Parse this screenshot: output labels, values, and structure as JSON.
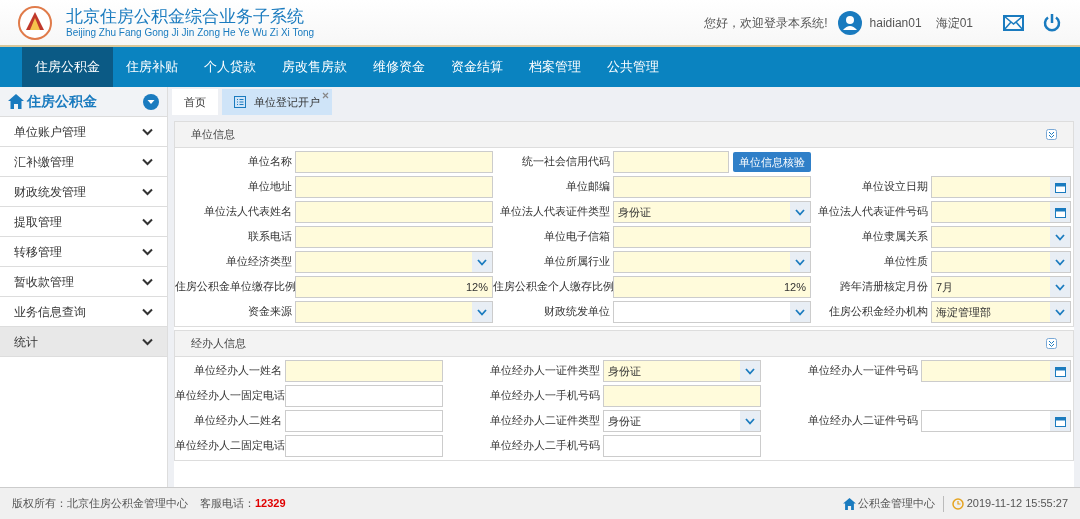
{
  "header": {
    "title": "北京住房公积金综合业务子系统",
    "subtitle": "Beijing Zhu Fang Gong Ji Jin Zong He Ye Wu Zi Xi Tong",
    "greeting": "您好，欢迎登录本系统!",
    "username": "haidian01",
    "org": "海淀01"
  },
  "nav": [
    {
      "label": "住房公积金",
      "selected": true
    },
    {
      "label": "住房补贴",
      "selected": false
    },
    {
      "label": "个人贷款",
      "selected": false
    },
    {
      "label": "房改售房款",
      "selected": false
    },
    {
      "label": "维修资金",
      "selected": false
    },
    {
      "label": "资金结算",
      "selected": false
    },
    {
      "label": "档案管理",
      "selected": false
    },
    {
      "label": "公共管理",
      "selected": false
    }
  ],
  "sidebar": {
    "title": "住房公积金",
    "items": [
      {
        "label": "单位账户管理",
        "selected": false
      },
      {
        "label": "汇补缴管理",
        "selected": false
      },
      {
        "label": "财政统发管理",
        "selected": false
      },
      {
        "label": "提取管理",
        "selected": false
      },
      {
        "label": "转移管理",
        "selected": false
      },
      {
        "label": "暂收款管理",
        "selected": false
      },
      {
        "label": "业务信息查询",
        "selected": false
      },
      {
        "label": "统计",
        "selected": true
      }
    ]
  },
  "tabs": [
    {
      "label": "首页",
      "selected": false,
      "closable": false
    },
    {
      "label": "单位登记开户",
      "selected": true,
      "closable": true
    }
  ],
  "sections": [
    {
      "title": "单位信息",
      "rows": [
        [
          {
            "label": "单位名称",
            "kind": "text",
            "required": true
          },
          {
            "label": "统一社会信用代码",
            "kind": "text",
            "required": true,
            "button": "单位信息核验"
          },
          null
        ],
        [
          {
            "label": "单位地址",
            "kind": "text",
            "required": true
          },
          {
            "label": "单位邮编",
            "kind": "text",
            "required": true
          },
          {
            "label": "单位设立日期",
            "kind": "date",
            "required": true
          }
        ],
        [
          {
            "label": "单位法人代表姓名",
            "kind": "text",
            "required": true
          },
          {
            "label": "单位法人代表证件类型",
            "kind": "select",
            "required": true,
            "value": "身份证"
          },
          {
            "label": "单位法人代表证件号码",
            "kind": "date",
            "required": true
          }
        ],
        [
          {
            "label": "联系电话",
            "kind": "text",
            "required": true
          },
          {
            "label": "单位电子信箱",
            "kind": "text",
            "required": true
          },
          {
            "label": "单位隶属关系",
            "kind": "select",
            "required": true
          }
        ],
        [
          {
            "label": "单位经济类型",
            "kind": "select",
            "required": true
          },
          {
            "label": "单位所属行业",
            "kind": "select",
            "required": true
          },
          {
            "label": "单位性质",
            "kind": "select",
            "required": true
          }
        ],
        [
          {
            "label": "住房公积金单位缴存比例",
            "kind": "number",
            "required": true,
            "value": "12%"
          },
          {
            "label": "住房公积金个人缴存比例",
            "kind": "number",
            "required": true,
            "value": "12%"
          },
          {
            "label": "跨年清册核定月份",
            "kind": "select",
            "required": true,
            "value": "7月"
          }
        ],
        [
          {
            "label": "资金来源",
            "kind": "select",
            "required": true
          },
          {
            "label": "财政统发单位",
            "kind": "select",
            "required": false
          },
          {
            "label": "住房公积金经办机构",
            "kind": "select",
            "required": true,
            "value": "海淀管理部"
          }
        ]
      ]
    },
    {
      "title": "经办人信息",
      "rows": [
        [
          {
            "label": "单位经办人一姓名",
            "kind": "text",
            "required": true
          },
          {
            "label": "单位经办人一证件类型",
            "kind": "select",
            "required": true,
            "value": "身份证"
          },
          {
            "label": "单位经办人一证件号码",
            "kind": "date",
            "required": true
          }
        ],
        [
          {
            "label": "单位经办人一固定电话",
            "kind": "text",
            "required": false
          },
          {
            "label": "单位经办人一手机号码",
            "kind": "text",
            "required": true
          },
          null
        ],
        [
          {
            "label": "单位经办人二姓名",
            "kind": "text",
            "required": false
          },
          {
            "label": "单位经办人二证件类型",
            "kind": "select",
            "required": false,
            "value": "身份证"
          },
          {
            "label": "单位经办人二证件号码",
            "kind": "date",
            "required": false
          }
        ],
        [
          {
            "label": "单位经办人二固定电话",
            "kind": "text",
            "required": false
          },
          {
            "label": "单位经办人二手机号码",
            "kind": "text",
            "required": false
          },
          null
        ]
      ]
    }
  ],
  "footer": {
    "copyright": "版权所有：北京住房公积金管理中心",
    "hotline_label": "客服电话：",
    "hotline": "12329",
    "center": "公积金管理中心",
    "datetime": "2019-11-12 15:55:27"
  }
}
